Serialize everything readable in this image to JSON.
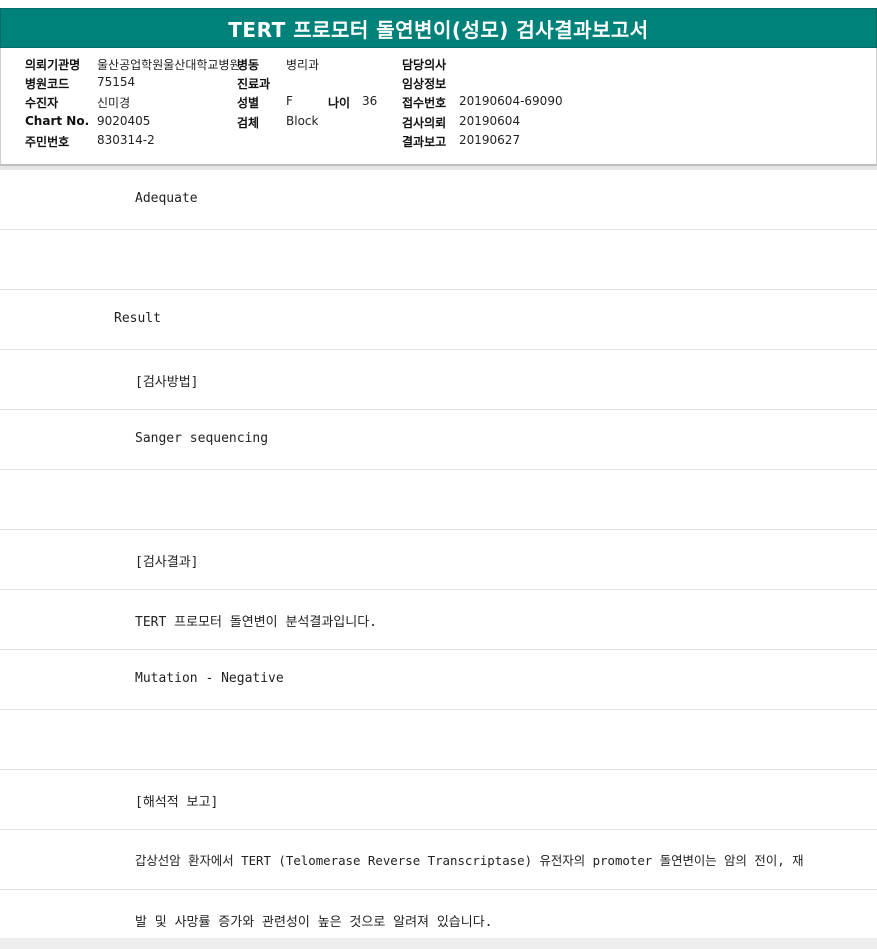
{
  "header": {
    "title": "TERT 프로모터 돌연변이(성모) 검사결과보고서"
  },
  "info": {
    "row1": {
      "l1": "의뢰기관명",
      "v1": "울산공업학원울산대학교병원",
      "l2": "병동",
      "v2": "병리과",
      "l3": "담당의사",
      "v3": ""
    },
    "row2": {
      "l1": "병원코드",
      "v1": "75154",
      "l2": "진료과",
      "v2": "",
      "l3": "임상정보",
      "v3": ""
    },
    "row3": {
      "l1": "수진자",
      "v1": "신미경",
      "l2": "성별",
      "v2": "F",
      "l2b": "나이",
      "v2b": "36",
      "l3": "접수번호",
      "v3": "20190604-69090"
    },
    "row4": {
      "l1": "Chart No.",
      "v1": "9020405",
      "l2": "검체",
      "v2": "Block",
      "l3": "검사의뢰",
      "v3": "20190604"
    },
    "row5": {
      "l1": "주민번호",
      "v1": "830314-2",
      "l3": "결과보고",
      "v3": "20190627"
    }
  },
  "report": {
    "lines": [
      "Adequate",
      "",
      "Result",
      "[검사방법]",
      "Sanger sequencing",
      "",
      "[검사결과]",
      "TERT 프로모터 돌연변이 분석결과입니다.",
      "Mutation - Negative",
      "",
      "[해석적 보고]",
      "갑상선암 환자에서 TERT (Telomerase Reverse Transcriptase) 유전자의 promoter 돌연변이는 암의 전이, 재",
      "발 및 사망률 증가와 관련성이 높은 것으로 알려져 있습니다."
    ]
  }
}
